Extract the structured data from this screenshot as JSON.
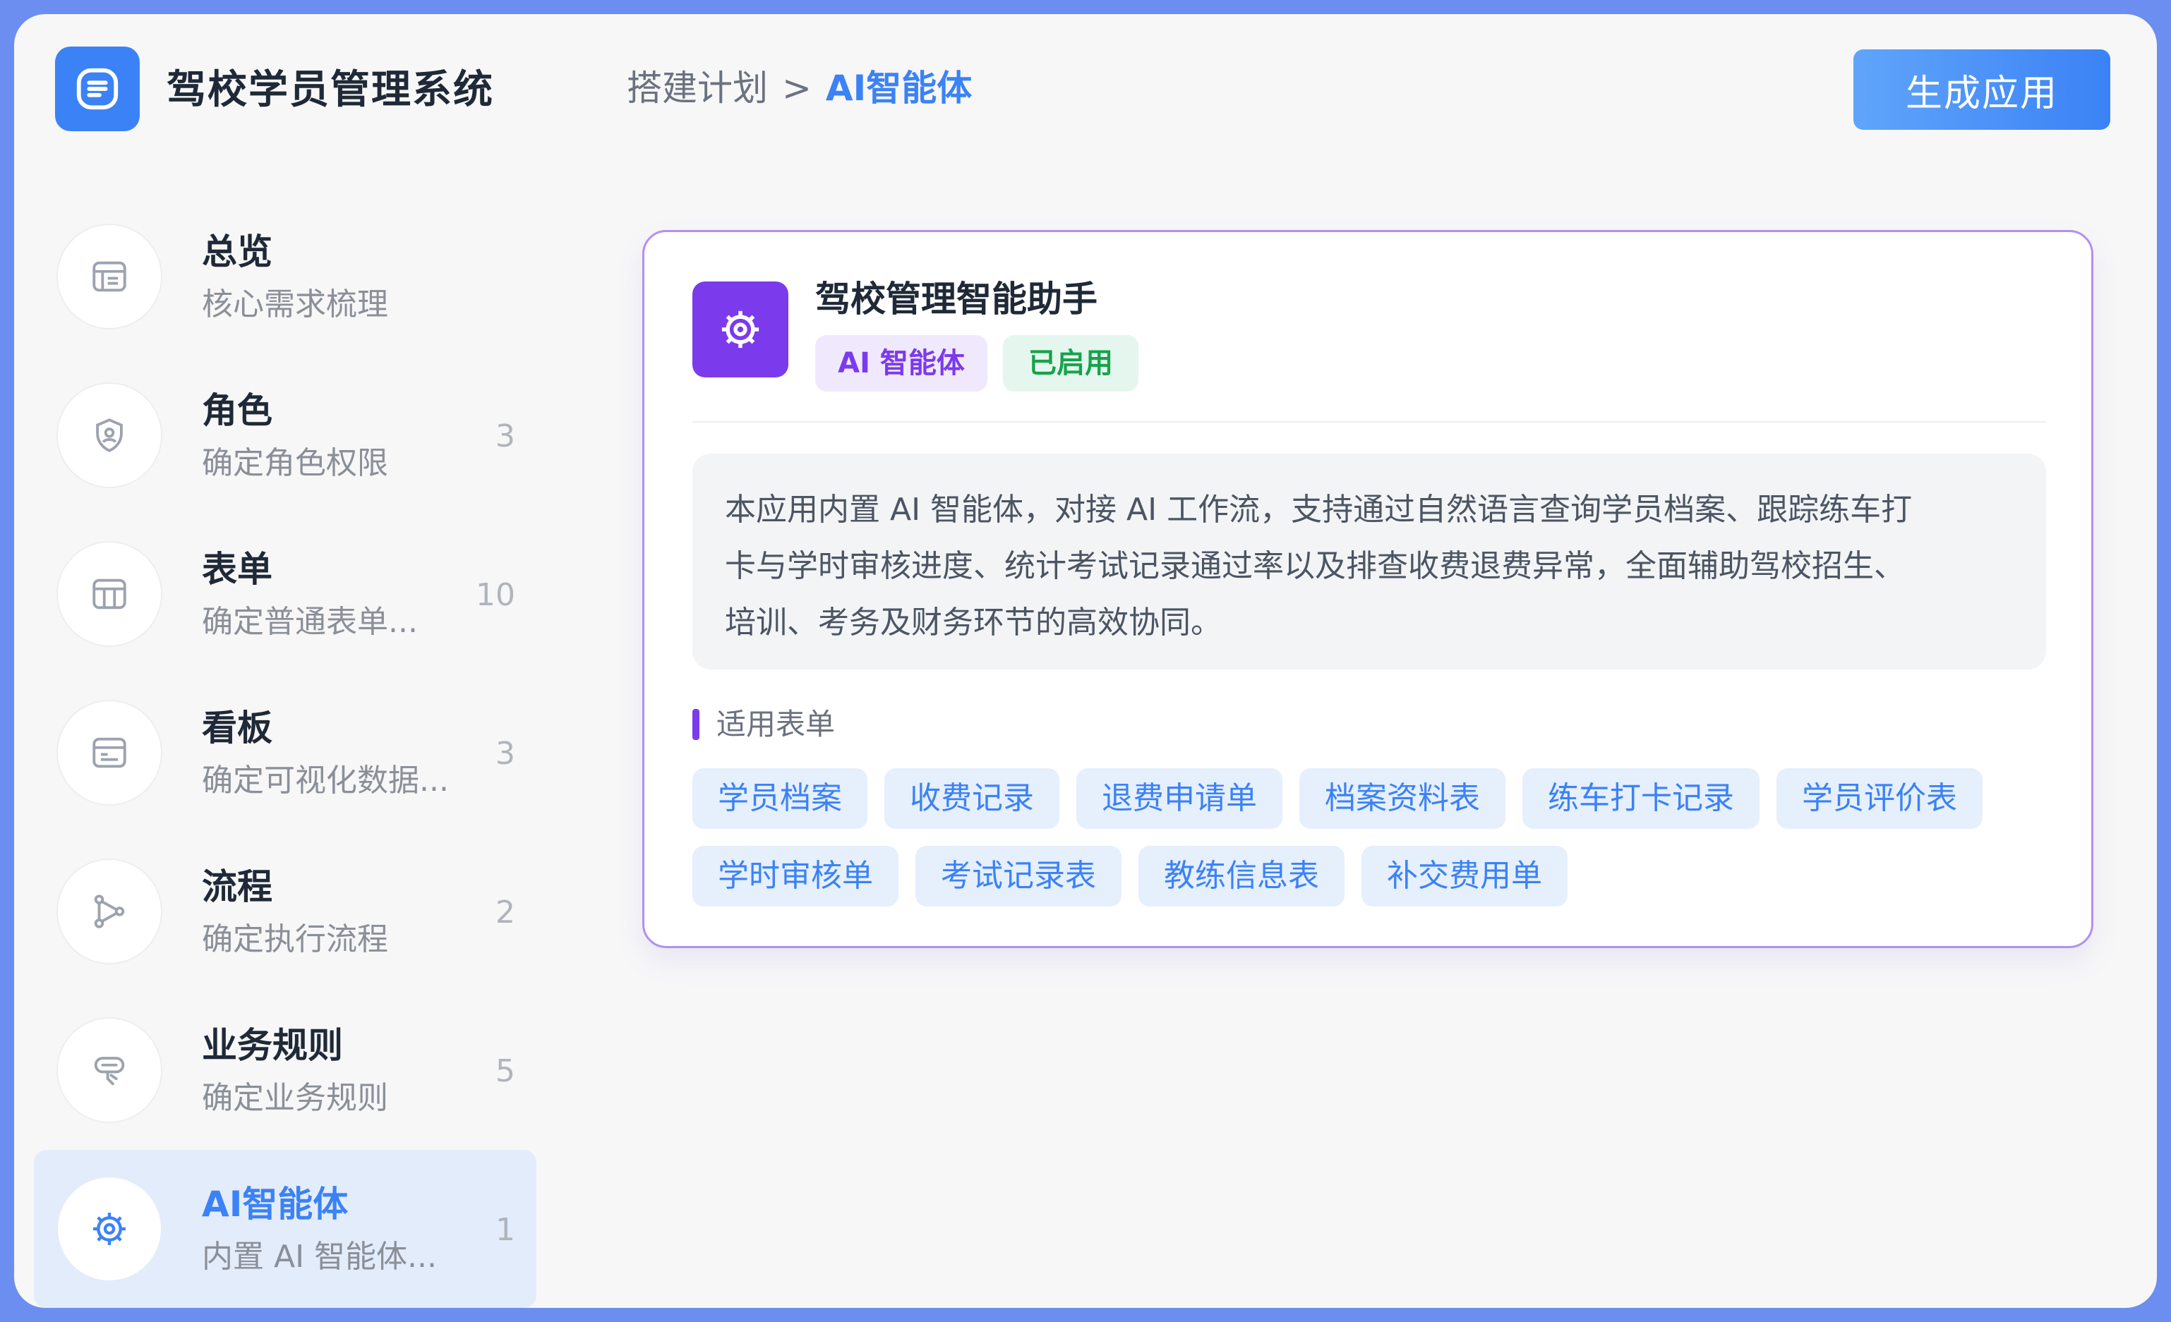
{
  "header": {
    "app_title": "驾校学员管理系统",
    "breadcrumb_parent": "搭建计划",
    "breadcrumb_sep": ">",
    "breadcrumb_current": "AI智能体",
    "generate_label": "生成应用"
  },
  "sidebar": {
    "items": [
      {
        "title": "总览",
        "subtitle": "核心需求梳理",
        "count": "",
        "icon": "layout-icon"
      },
      {
        "title": "角色",
        "subtitle": "确定角色权限",
        "count": "3",
        "icon": "shield-user-icon"
      },
      {
        "title": "表单",
        "subtitle": "确定普通表单...",
        "count": "10",
        "icon": "table-icon"
      },
      {
        "title": "看板",
        "subtitle": "确定可视化数据...",
        "count": "3",
        "icon": "dashboard-icon"
      },
      {
        "title": "流程",
        "subtitle": "确定执行流程",
        "count": "2",
        "icon": "workflow-icon"
      },
      {
        "title": "业务规则",
        "subtitle": "确定业务规则",
        "count": "5",
        "icon": "rule-icon"
      },
      {
        "title": "AI智能体",
        "subtitle": "内置 AI 智能体...",
        "count": "1",
        "icon": "gear-icon"
      }
    ]
  },
  "agent": {
    "name": "驾校管理智能助手",
    "badge_type": "AI 智能体",
    "badge_status": "已启用",
    "description_line1": "本应用内置 AI 智能体，对接 AI 工作流，支持通过自然语言查询学员档案、跟踪练车打",
    "description_line2": "卡与学时审核进度、统计考试记录通过率以及排查收费退费异常，全面辅助驾校招生、",
    "description_line3": "培训、考务及财务环节的高效协同。",
    "forms_label": "适用表单",
    "forms": [
      "学员档案",
      "收费记录",
      "退费申请单",
      "档案资料表",
      "练车打卡记录",
      "学员评价表",
      "学时审核单",
      "考试记录表",
      "教练信息表",
      "补交费用单"
    ]
  },
  "colors": {
    "accent": "#3b82f6",
    "agent_purple": "#7c3aed",
    "card_border": "#b58ef0",
    "status_green": "#16a34a"
  }
}
